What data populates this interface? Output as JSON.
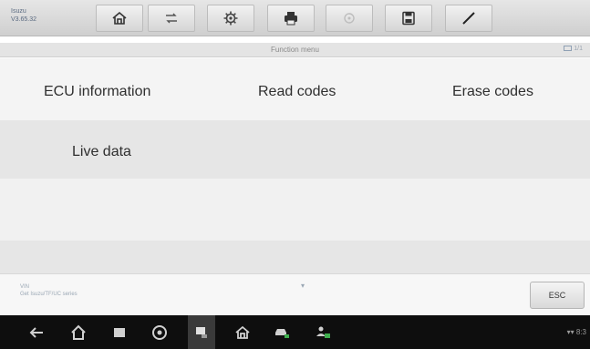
{
  "vehicle": {
    "make": "Isuzu",
    "version": "V3.65.32"
  },
  "toolbar": {
    "buttons": [
      "home",
      "vehicle-swap",
      "settings",
      "print",
      "help",
      "save",
      "data-logging"
    ]
  },
  "function_menu": {
    "title": "Function menu",
    "page_indicator": "1/1",
    "items": {
      "ecu_information": "ECU information",
      "read_codes": "Read codes",
      "erase_codes": "Erase codes",
      "live_data": "Live data"
    }
  },
  "status": {
    "vin_label": "VIN",
    "path": "Get Isuzu/TF/UC series",
    "esc_label": "ESC"
  },
  "navbar": {
    "clock": "8:3"
  }
}
